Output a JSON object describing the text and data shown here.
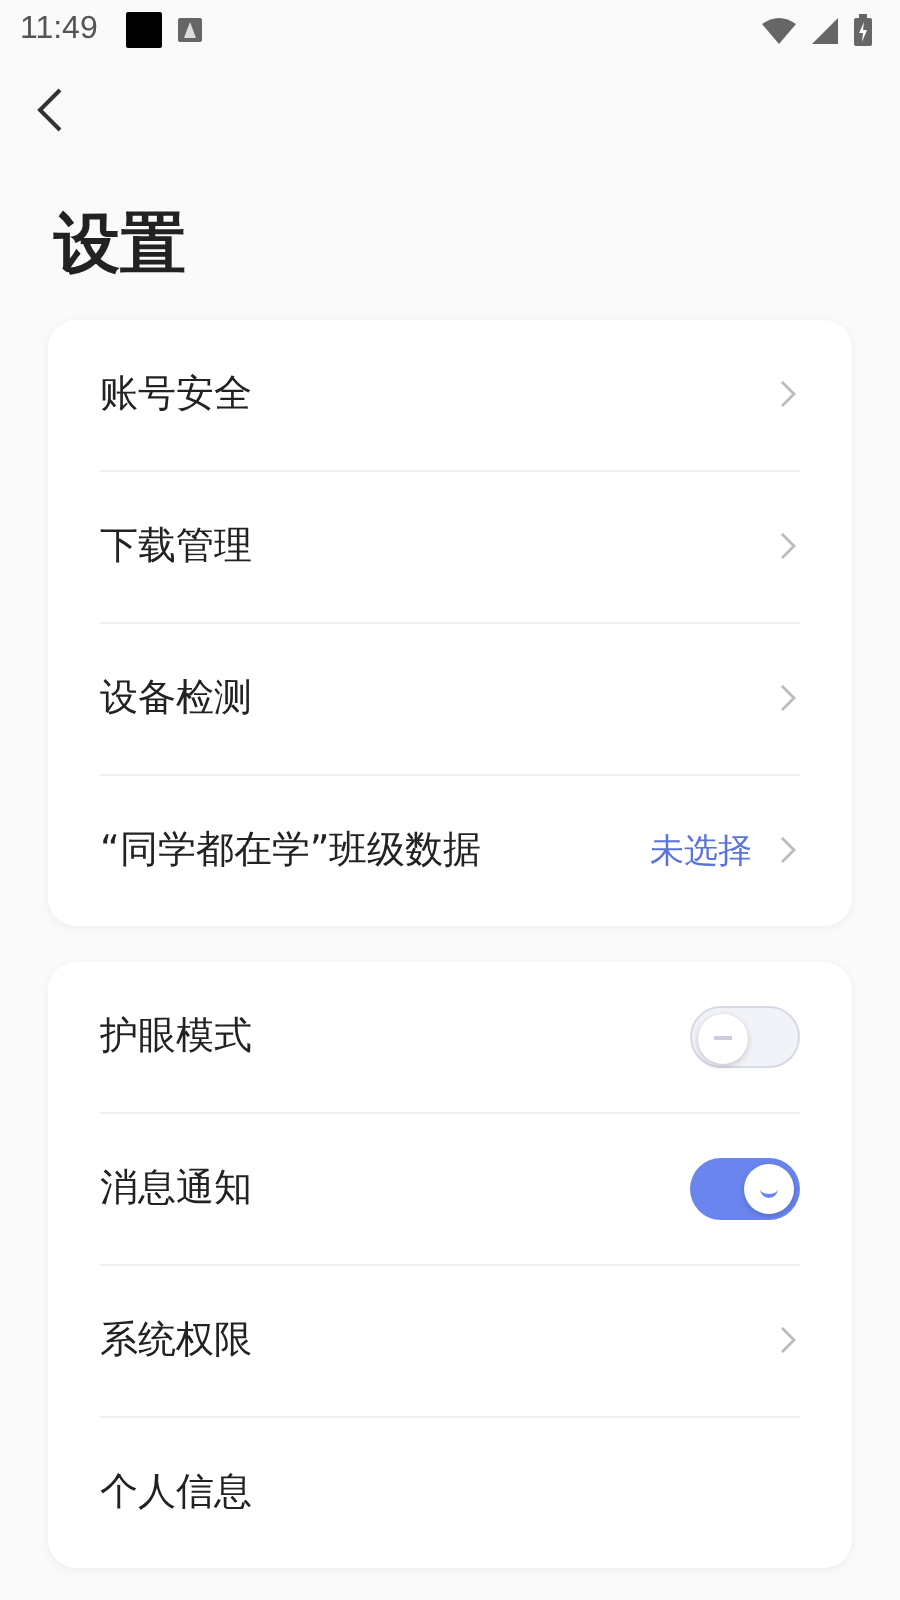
{
  "status_bar": {
    "time": "11:49"
  },
  "title": "设置",
  "groups": [
    {
      "items": [
        {
          "kind": "link",
          "label": "账号安全"
        },
        {
          "kind": "link",
          "label": "下载管理"
        },
        {
          "kind": "link",
          "label": "设备检测"
        },
        {
          "kind": "link",
          "label": "“同学都在学”班级数据",
          "value": "未选择"
        }
      ]
    },
    {
      "items": [
        {
          "kind": "toggle",
          "label": "护眼模式",
          "on": false
        },
        {
          "kind": "toggle",
          "label": "消息通知",
          "on": true
        },
        {
          "kind": "link",
          "label": "系统权限"
        },
        {
          "kind": "plain",
          "label": "个人信息"
        }
      ]
    }
  ]
}
